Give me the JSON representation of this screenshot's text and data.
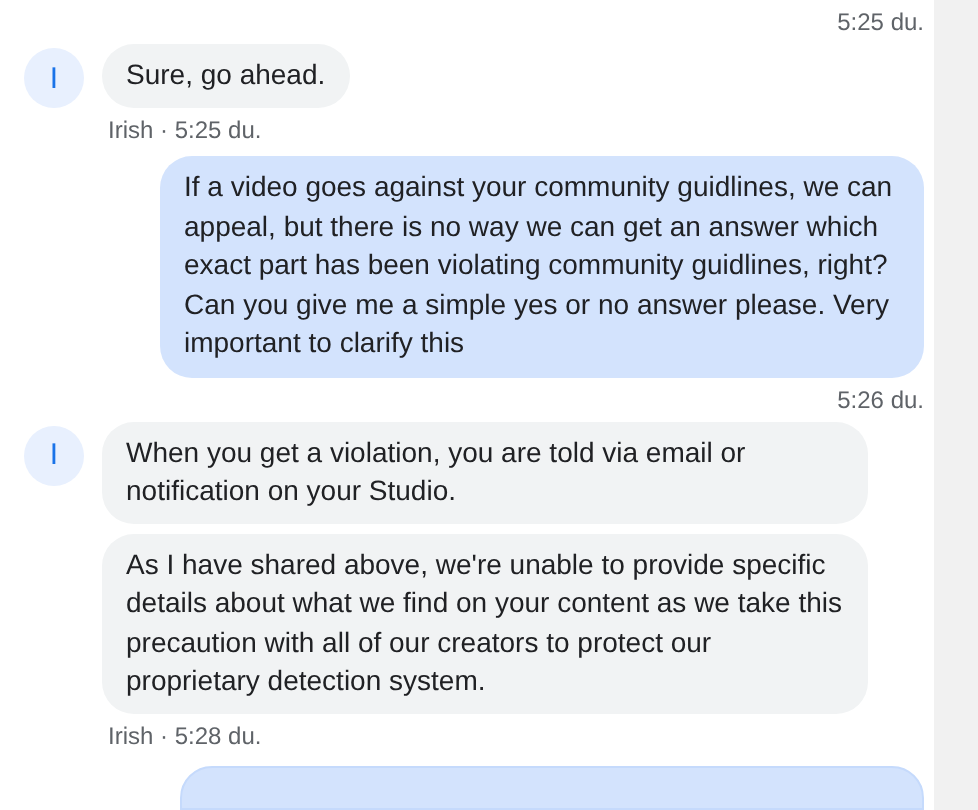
{
  "top_time": "5:25 du.",
  "messages": [
    {
      "kind": "incoming",
      "avatar": "I",
      "bubbles": [
        "Sure, go ahead."
      ],
      "meta": "Irish · 5:25 du."
    },
    {
      "kind": "outgoing",
      "bubbles": [
        "If a video goes against your community guidlines, we can appeal, but there is no way we can get an answer which exact part has been violating community guidlines, right?\nCan you give me a simple yes or no answer please. Very important to clarify this"
      ],
      "meta": "5:26 du."
    },
    {
      "kind": "incoming",
      "avatar": "I",
      "bubbles": [
        "When you get a violation, you are told via email or notification on your Studio.",
        "As I have shared above, we're unable to provide specific details about what we find on your content as we take this precaution with all of our creators to protect our proprietary detection system."
      ],
      "meta": "Irish · 5:28 du."
    }
  ]
}
